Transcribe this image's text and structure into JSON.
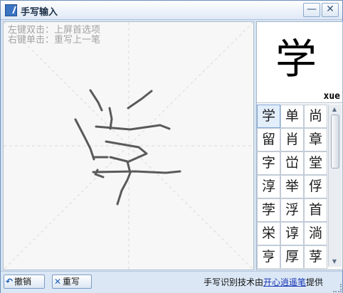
{
  "window": {
    "title": "手写输入"
  },
  "titlebar": {
    "minimize": "—",
    "close": "✕"
  },
  "canvas": {
    "hint_line1": "左键双击：上屏首选项",
    "hint_line2": "右键单击：重写上一笔"
  },
  "preview": {
    "character": "学",
    "pinyin": "xue"
  },
  "candidates": [
    "学",
    "单",
    "尚",
    "留",
    "肖",
    "章",
    "字",
    "峃",
    "堂",
    "淳",
    "举",
    "俘",
    "茡",
    "浮",
    "首",
    "栄",
    "谆",
    "淌",
    "亨",
    "厚",
    "莩"
  ],
  "scroll": {
    "up": "▲",
    "down": "▼"
  },
  "buttons": {
    "undo": "撤销",
    "rewrite": "重写"
  },
  "footer": {
    "prefix": "手写识别技术由",
    "link": "开心逍遥笔",
    "suffix": "提供"
  },
  "icons": {
    "undo": "undo-arrow-icon",
    "rewrite": "clear-x-icon",
    "app": "pen-icon"
  }
}
